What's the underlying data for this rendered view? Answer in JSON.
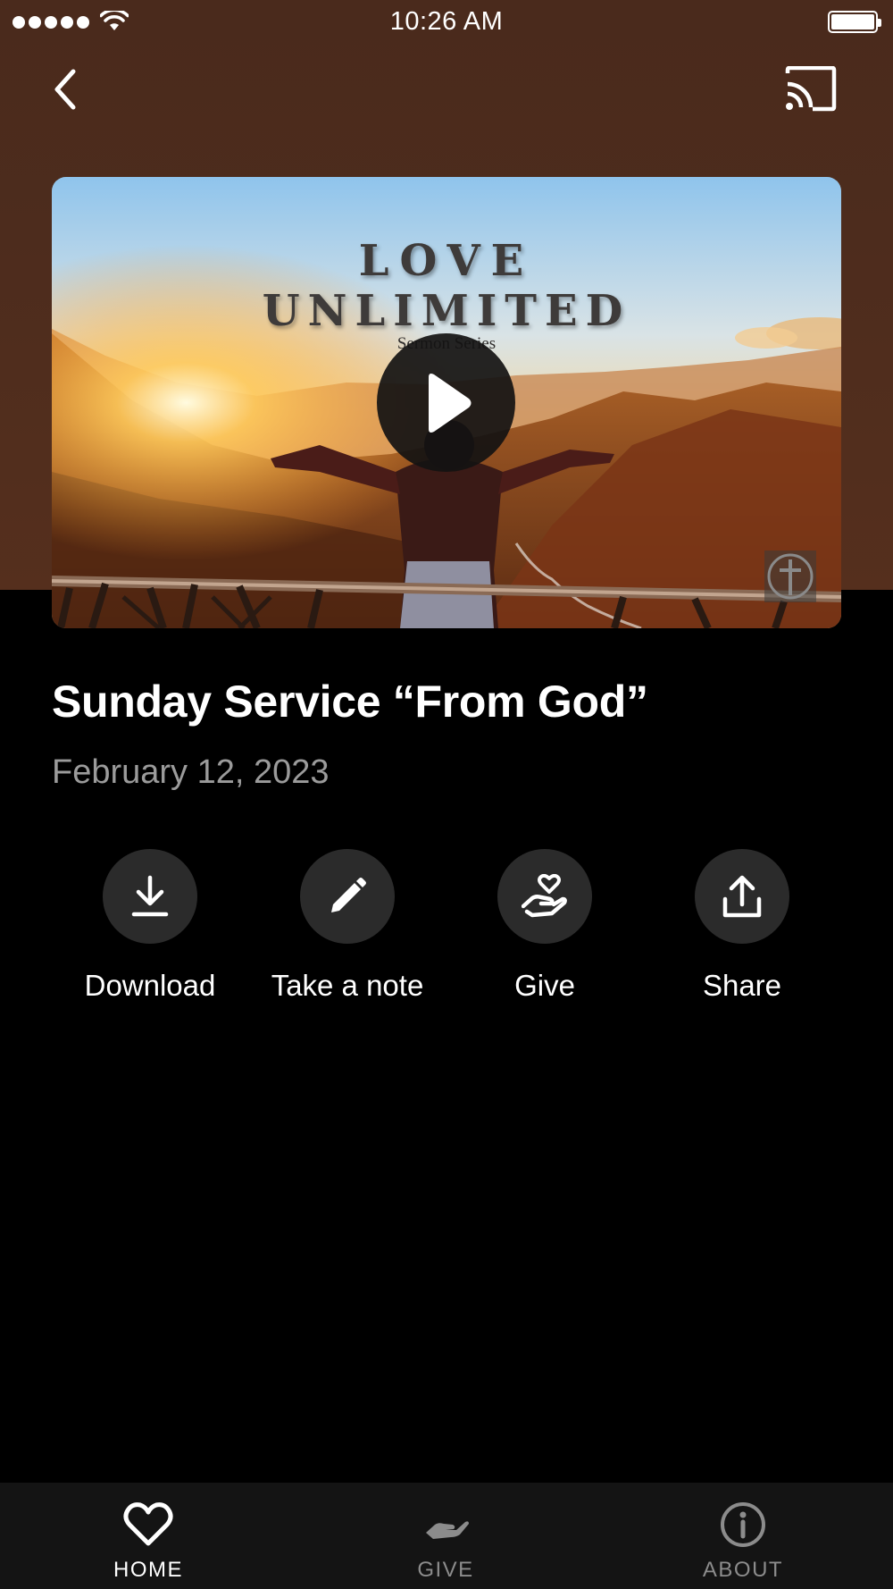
{
  "status_bar": {
    "time": "10:26 AM"
  },
  "nav": {
    "back_icon": "chevron-left-icon",
    "cast_icon": "cast-icon"
  },
  "video": {
    "series_line1": "LOVE",
    "series_line2": "UNLIMITED",
    "series_subtitle": "Sermon Series",
    "play_icon": "play-icon"
  },
  "sermon": {
    "title": "Sunday Service “From God”",
    "date": "February 12, 2023"
  },
  "actions": [
    {
      "label": "Download",
      "icon": "download-icon"
    },
    {
      "label": "Take a note",
      "icon": "pencil-icon"
    },
    {
      "label": "Give",
      "icon": "heart-hand-icon"
    },
    {
      "label": "Share",
      "icon": "share-icon"
    }
  ],
  "tabs": [
    {
      "label": "HOME",
      "icon": "heart-icon",
      "active": true
    },
    {
      "label": "GIVE",
      "icon": "hand-icon",
      "active": false
    },
    {
      "label": "ABOUT",
      "icon": "info-icon",
      "active": false
    }
  ],
  "colors": {
    "header_background": "#4d2c1d",
    "page_background": "#000000",
    "action_circle": "#2b2b2b",
    "tab_bar": "#141414",
    "inactive_tab": "#8c8c8c",
    "date_text": "#9b9b9b"
  }
}
